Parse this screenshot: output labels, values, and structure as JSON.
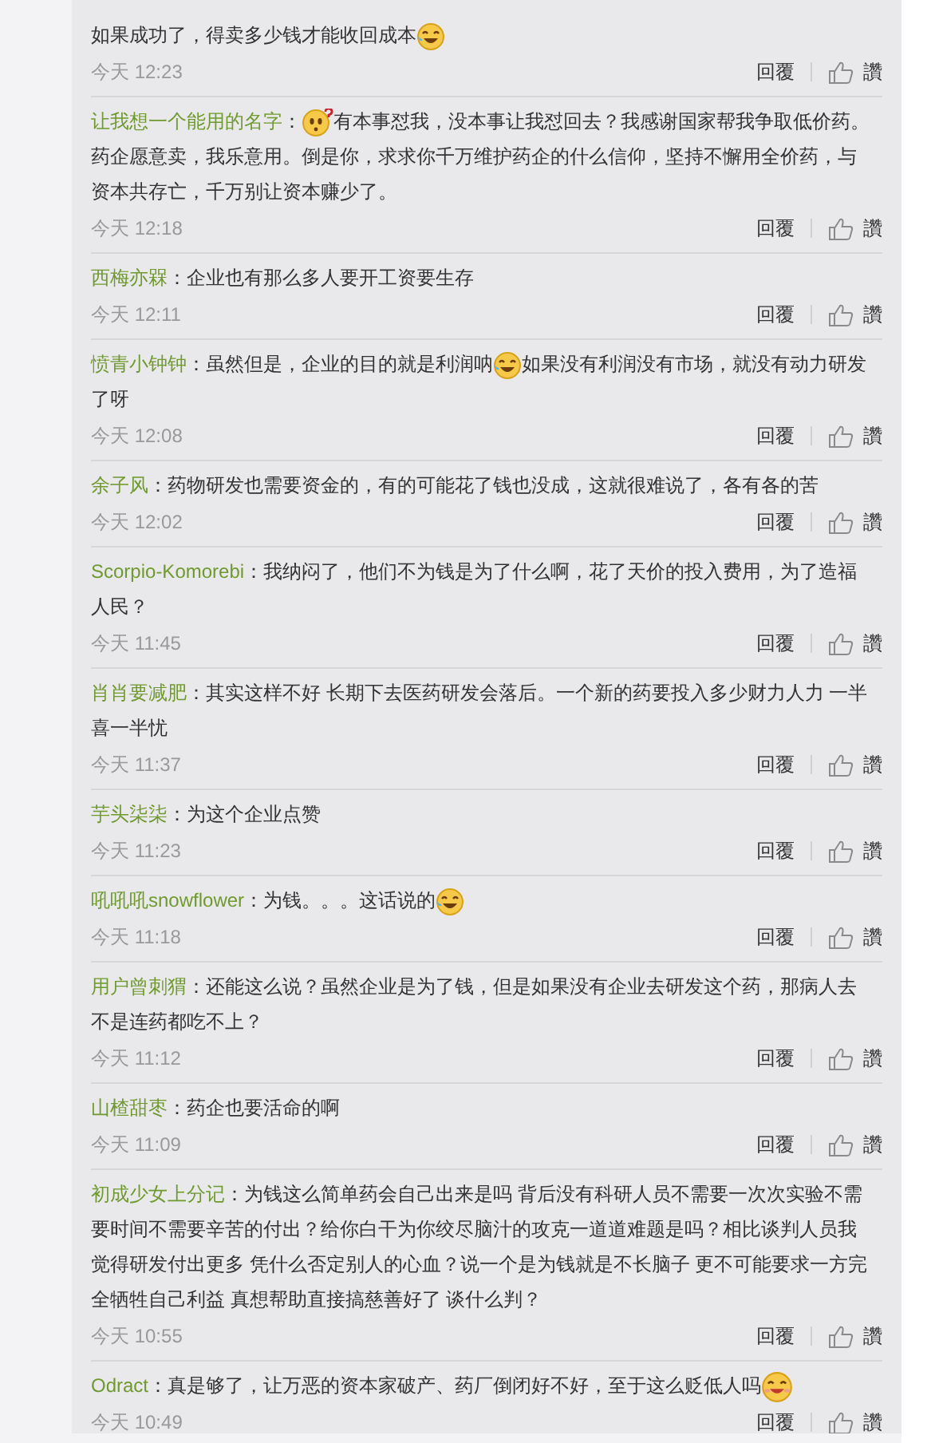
{
  "comments": [
    {
      "parts": [
        {
          "kind": "text",
          "text": "如果成功了，得卖多少钱才能收回成本"
        },
        {
          "kind": "laugh-emoji"
        }
      ],
      "time": "今天 12:23",
      "reply": "回覆",
      "like": "讚"
    },
    {
      "name": "让我想一个能用的名字",
      "parts": [
        {
          "kind": "text",
          "text": "："
        },
        {
          "kind": "puzzled-emoji"
        },
        {
          "kind": "text",
          "text": "有本事怼我，没本事让我怼回去？我感谢国家帮我争取低价药。药企愿意卖，我乐意用。倒是你，求求你千万维护药企的什么信仰，坚持不懈用全价药，与资本共存亡，千万别让资本赚少了。"
        }
      ],
      "time": "今天 12:18",
      "reply": "回覆",
      "like": "讚"
    },
    {
      "name": "西梅亦槑",
      "parts": [
        {
          "kind": "text",
          "text": "：企业也有那么多人要开工资要生存"
        }
      ],
      "time": "今天 12:11",
      "reply": "回覆",
      "like": "讚"
    },
    {
      "name": "愤青小钟钟",
      "parts": [
        {
          "kind": "text",
          "text": "：虽然但是，企业的目的就是利润呐"
        },
        {
          "kind": "laugh-emoji"
        },
        {
          "kind": "text",
          "text": "如果没有利润没有市场，就没有动力研发了呀"
        }
      ],
      "time": "今天 12:08",
      "reply": "回覆",
      "like": "讚"
    },
    {
      "name": "余子风",
      "parts": [
        {
          "kind": "text",
          "text": "：药物研发也需要资金的，有的可能花了钱也没成，这就很难说了，各有各的苦"
        }
      ],
      "time": "今天 12:02",
      "reply": "回覆",
      "like": "讚"
    },
    {
      "name": "Scorpio-Komorebi",
      "parts": [
        {
          "kind": "text",
          "text": "：我纳闷了，他们不为钱是为了什么啊，花了天价的投入费用，为了造福人民？"
        }
      ],
      "time": "今天 11:45",
      "reply": "回覆",
      "like": "讚"
    },
    {
      "name": "肖肖要减肥",
      "parts": [
        {
          "kind": "text",
          "text": "：其实这样不好 长期下去医药研发会落后。一个新的药要投入多少财力人力 一半喜一半忧"
        }
      ],
      "time": "今天 11:37",
      "reply": "回覆",
      "like": "讚"
    },
    {
      "name": "芋头柒柒",
      "parts": [
        {
          "kind": "text",
          "text": "：为这个企业点赞"
        }
      ],
      "time": "今天 11:23",
      "reply": "回覆",
      "like": "讚"
    },
    {
      "name": "吼吼吼snowflower",
      "parts": [
        {
          "kind": "text",
          "text": "：为钱。。。这话说的"
        },
        {
          "kind": "laugh-emoji"
        }
      ],
      "time": "今天 11:18",
      "reply": "回覆",
      "like": "讚"
    },
    {
      "name": "用户曾刺猬",
      "parts": [
        {
          "kind": "text",
          "text": "：还能这么说？虽然企业是为了钱，但是如果没有企业去研发这个药，那病人去不是连药都吃不上？"
        }
      ],
      "time": "今天 11:12",
      "reply": "回覆",
      "like": "讚"
    },
    {
      "name": "山楂甜枣",
      "parts": [
        {
          "kind": "text",
          "text": "：药企也要活命的啊"
        }
      ],
      "time": "今天 11:09",
      "reply": "回覆",
      "like": "讚"
    },
    {
      "name": "初成少女上分记",
      "parts": [
        {
          "kind": "text",
          "text": "：为钱这么简单药会自己出来是吗 背后没有科研人员不需要一次次实验不需要时间不需要辛苦的付出？给你白干为你绞尽脑汁的攻克一道道难题是吗？相比谈判人员我觉得研发付出更多 凭什么否定别人的心血？说一个是为钱就是不长脑子 更不可能要求一方完全牺牲自己利益 真想帮助直接搞慈善好了 谈什么判？"
        }
      ],
      "time": "今天 10:55",
      "reply": "回覆",
      "like": "讚"
    },
    {
      "name": "Odract",
      "parts": [
        {
          "kind": "text",
          "text": "：真是够了，让万恶的资本家破产、药厂倒闭好不好，至于这么贬低人吗"
        },
        {
          "kind": "grin-emoji"
        }
      ],
      "time": "今天 10:49",
      "reply": "回覆",
      "like": "讚"
    }
  ]
}
